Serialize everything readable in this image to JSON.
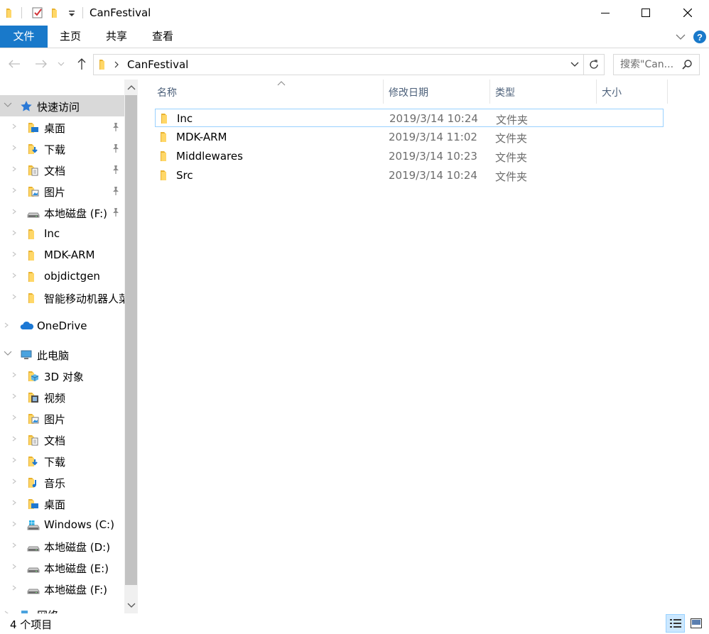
{
  "window": {
    "title": "CanFestival",
    "minimize_icon": "minimize-icon",
    "maximize_icon": "maximize-icon",
    "close_icon": "close-icon"
  },
  "ribbon": {
    "tabs": [
      {
        "label": "文件",
        "active": true
      },
      {
        "label": "主页"
      },
      {
        "label": "共享"
      },
      {
        "label": "查看"
      }
    ]
  },
  "address": {
    "path": "CanFestival"
  },
  "search": {
    "placeholder": "搜索\"Can..."
  },
  "nav": {
    "items": [
      {
        "label": "快速访问",
        "icon": "star-icon",
        "level": 0,
        "selected": true
      },
      {
        "label": "桌面",
        "icon": "desktop-folder-icon",
        "level": 1,
        "pinned": true
      },
      {
        "label": "下载",
        "icon": "downloads-folder-icon",
        "level": 1,
        "pinned": true
      },
      {
        "label": "文档",
        "icon": "documents-folder-icon",
        "level": 1,
        "pinned": true
      },
      {
        "label": "图片",
        "icon": "pictures-folder-icon",
        "level": 1,
        "pinned": true
      },
      {
        "label": "本地磁盘 (F:)",
        "icon": "drive-icon",
        "level": 1,
        "pinned": true
      },
      {
        "label": "Inc",
        "icon": "folder-icon",
        "level": 1
      },
      {
        "label": "MDK-ARM",
        "icon": "folder-icon",
        "level": 1
      },
      {
        "label": "objdictgen",
        "icon": "folder-icon",
        "level": 1
      },
      {
        "label": "智能移动机器人菜",
        "icon": "folder-icon",
        "level": 1
      },
      {
        "label": "OneDrive",
        "icon": "onedrive-icon",
        "level": 0
      },
      {
        "label": "此电脑",
        "icon": "computer-icon",
        "level": 0
      },
      {
        "label": "3D 对象",
        "icon": "3d-objects-folder-icon",
        "level": 1
      },
      {
        "label": "视频",
        "icon": "videos-folder-icon",
        "level": 1
      },
      {
        "label": "图片",
        "icon": "pictures-folder-icon",
        "level": 1
      },
      {
        "label": "文档",
        "icon": "documents-folder-icon",
        "level": 1
      },
      {
        "label": "下载",
        "icon": "downloads-folder-icon",
        "level": 1
      },
      {
        "label": "音乐",
        "icon": "music-folder-icon",
        "level": 1
      },
      {
        "label": "桌面",
        "icon": "desktop-folder-icon",
        "level": 1
      },
      {
        "label": "Windows (C:)",
        "icon": "windows-drive-icon",
        "level": 1
      },
      {
        "label": "本地磁盘 (D:)",
        "icon": "drive-icon",
        "level": 1
      },
      {
        "label": "本地磁盘 (E:)",
        "icon": "drive-icon",
        "level": 1
      },
      {
        "label": "本地磁盘 (F:)",
        "icon": "drive-icon",
        "level": 1
      },
      {
        "label": "网络",
        "icon": "network-icon",
        "level": 0
      }
    ]
  },
  "columns": [
    {
      "label": "名称"
    },
    {
      "label": "修改日期"
    },
    {
      "label": "类型"
    },
    {
      "label": "大小"
    }
  ],
  "files": [
    {
      "name": "Inc",
      "date": "2019/3/14 10:24",
      "type": "文件夹",
      "focused": true
    },
    {
      "name": "MDK-ARM",
      "date": "2019/3/14 11:02",
      "type": "文件夹"
    },
    {
      "name": "Middlewares",
      "date": "2019/3/14 10:23",
      "type": "文件夹"
    },
    {
      "name": "Src",
      "date": "2019/3/14 10:24",
      "type": "文件夹"
    }
  ],
  "status": {
    "item_count": "4 个项目"
  },
  "colors": {
    "accent": "#1979ca",
    "folder": "#ffd768",
    "selection": "#cce8ff",
    "header_text": "#4c607a"
  }
}
